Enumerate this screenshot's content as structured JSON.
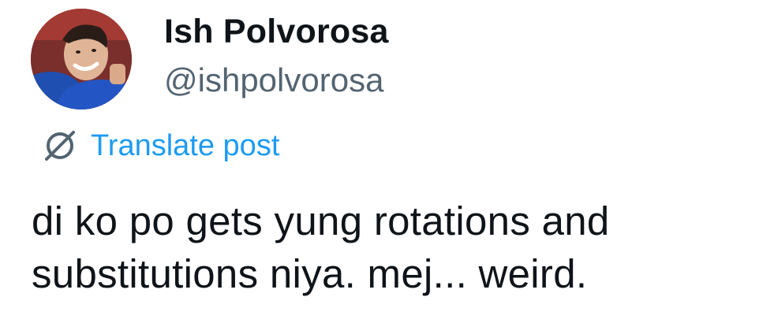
{
  "author": {
    "display_name": "Ish Polvorosa",
    "handle": "@ishpolvorosa",
    "avatar_icon": "user-avatar"
  },
  "translate": {
    "icon": "translate-icon",
    "label": "Translate post",
    "color": "#1d9bf0"
  },
  "post": {
    "lines": [
      "di ko po gets yung rotations and",
      "substitutions niya. mej... weird."
    ]
  },
  "colors": {
    "text_primary": "#0f1419",
    "text_secondary": "#536471",
    "link": "#1d9bf0",
    "background": "#ffffff"
  }
}
